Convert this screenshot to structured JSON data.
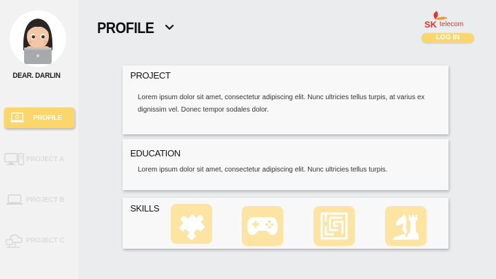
{
  "user": {
    "name": "DEAR. DARLIN"
  },
  "nav": {
    "items": [
      {
        "label": "PROFILE",
        "icon": "laptop-icon",
        "active": true
      },
      {
        "label": "PROJECT A",
        "icon": "desktop-icon",
        "active": false
      },
      {
        "label": "PROJECT B",
        "icon": "laptop-icon",
        "active": false
      },
      {
        "label": "PROJECT C",
        "icon": "cloud-network-icon",
        "active": false
      }
    ]
  },
  "header": {
    "title": "PROFILE",
    "dropdown_icon": "chevron-down-icon"
  },
  "brand": {
    "logo_sk": "SK",
    "logo_text": "telecom",
    "login_label": "LOG IN"
  },
  "sections": {
    "project": {
      "title": "PROJECT",
      "text": "Lorem ipsum dolor sit amet, consectetur adipiscing elit. Nunc ultricies tellus turpis, at varius ex dignissim vel. Donec tempor sodales dolor."
    },
    "education": {
      "title": "EDUCATION",
      "text": "Lorem ipsum dolor sit amet, consectetur adipiscing elit. Nunc ultricies tellus turpis."
    },
    "skills": {
      "title": "SKILLS",
      "icons": [
        "puzzle-icon",
        "gamepad-icon",
        "maze-icon",
        "chess-icon"
      ]
    }
  },
  "colors": {
    "accent": "#fbd66a",
    "accent_light": "#fde4a3",
    "brand_red": "#e8332a",
    "sidebar_bg": "#f2f2f2",
    "page_bg": "#ebecee",
    "card_bg": "#f8f8f8"
  }
}
